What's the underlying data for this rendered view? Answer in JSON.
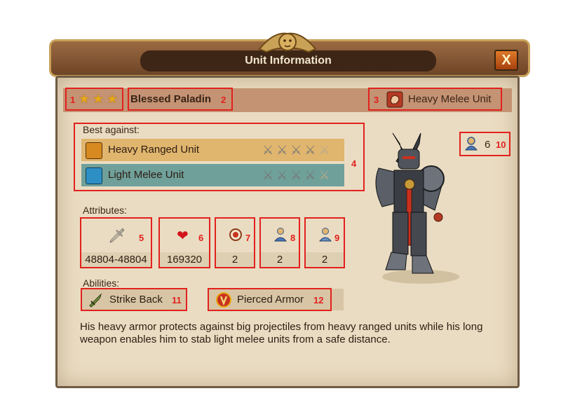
{
  "window": {
    "title": "Unit Information",
    "close_label": "X"
  },
  "unit": {
    "name": "Blessed Paladin",
    "type": "Heavy Melee Unit",
    "stars": 3,
    "count": "6"
  },
  "callouts": {
    "n1": "1",
    "n2": "2",
    "n3": "3",
    "n4": "4",
    "n5": "5",
    "n6": "6",
    "n7": "7",
    "n8": "8",
    "n9": "9",
    "n10": "10",
    "n11": "11",
    "n12": "12"
  },
  "best_against": {
    "label": "Best against:",
    "rows": [
      {
        "name": "Heavy Ranged Unit",
        "rating": 4,
        "max": 5
      },
      {
        "name": "Light Melee Unit",
        "rating": 4,
        "max": 5
      }
    ]
  },
  "attributes": {
    "label": "Attributes:",
    "items": [
      {
        "icon": "sword-icon",
        "value": "48804-48804"
      },
      {
        "icon": "heart-icon",
        "value": "169320"
      },
      {
        "icon": "target-icon",
        "value": "2"
      },
      {
        "icon": "unit-speed-icon",
        "value": "2"
      },
      {
        "icon": "unit-range-icon",
        "value": "2"
      }
    ]
  },
  "abilities": {
    "label": "Abilities:",
    "items": [
      {
        "name": "Strike Back",
        "icon": "strike-back-icon"
      },
      {
        "name": "Pierced Armor",
        "icon": "pierced-armor-icon"
      }
    ]
  },
  "description": "His heavy armor protects against big projectiles from heavy ranged units while his long weapon enables him to stab light melee units from a safe distance.",
  "colors": {
    "highlight": "#e2211d",
    "ranged_row": "#e0b56e",
    "melee_row": "#6fa09a"
  }
}
